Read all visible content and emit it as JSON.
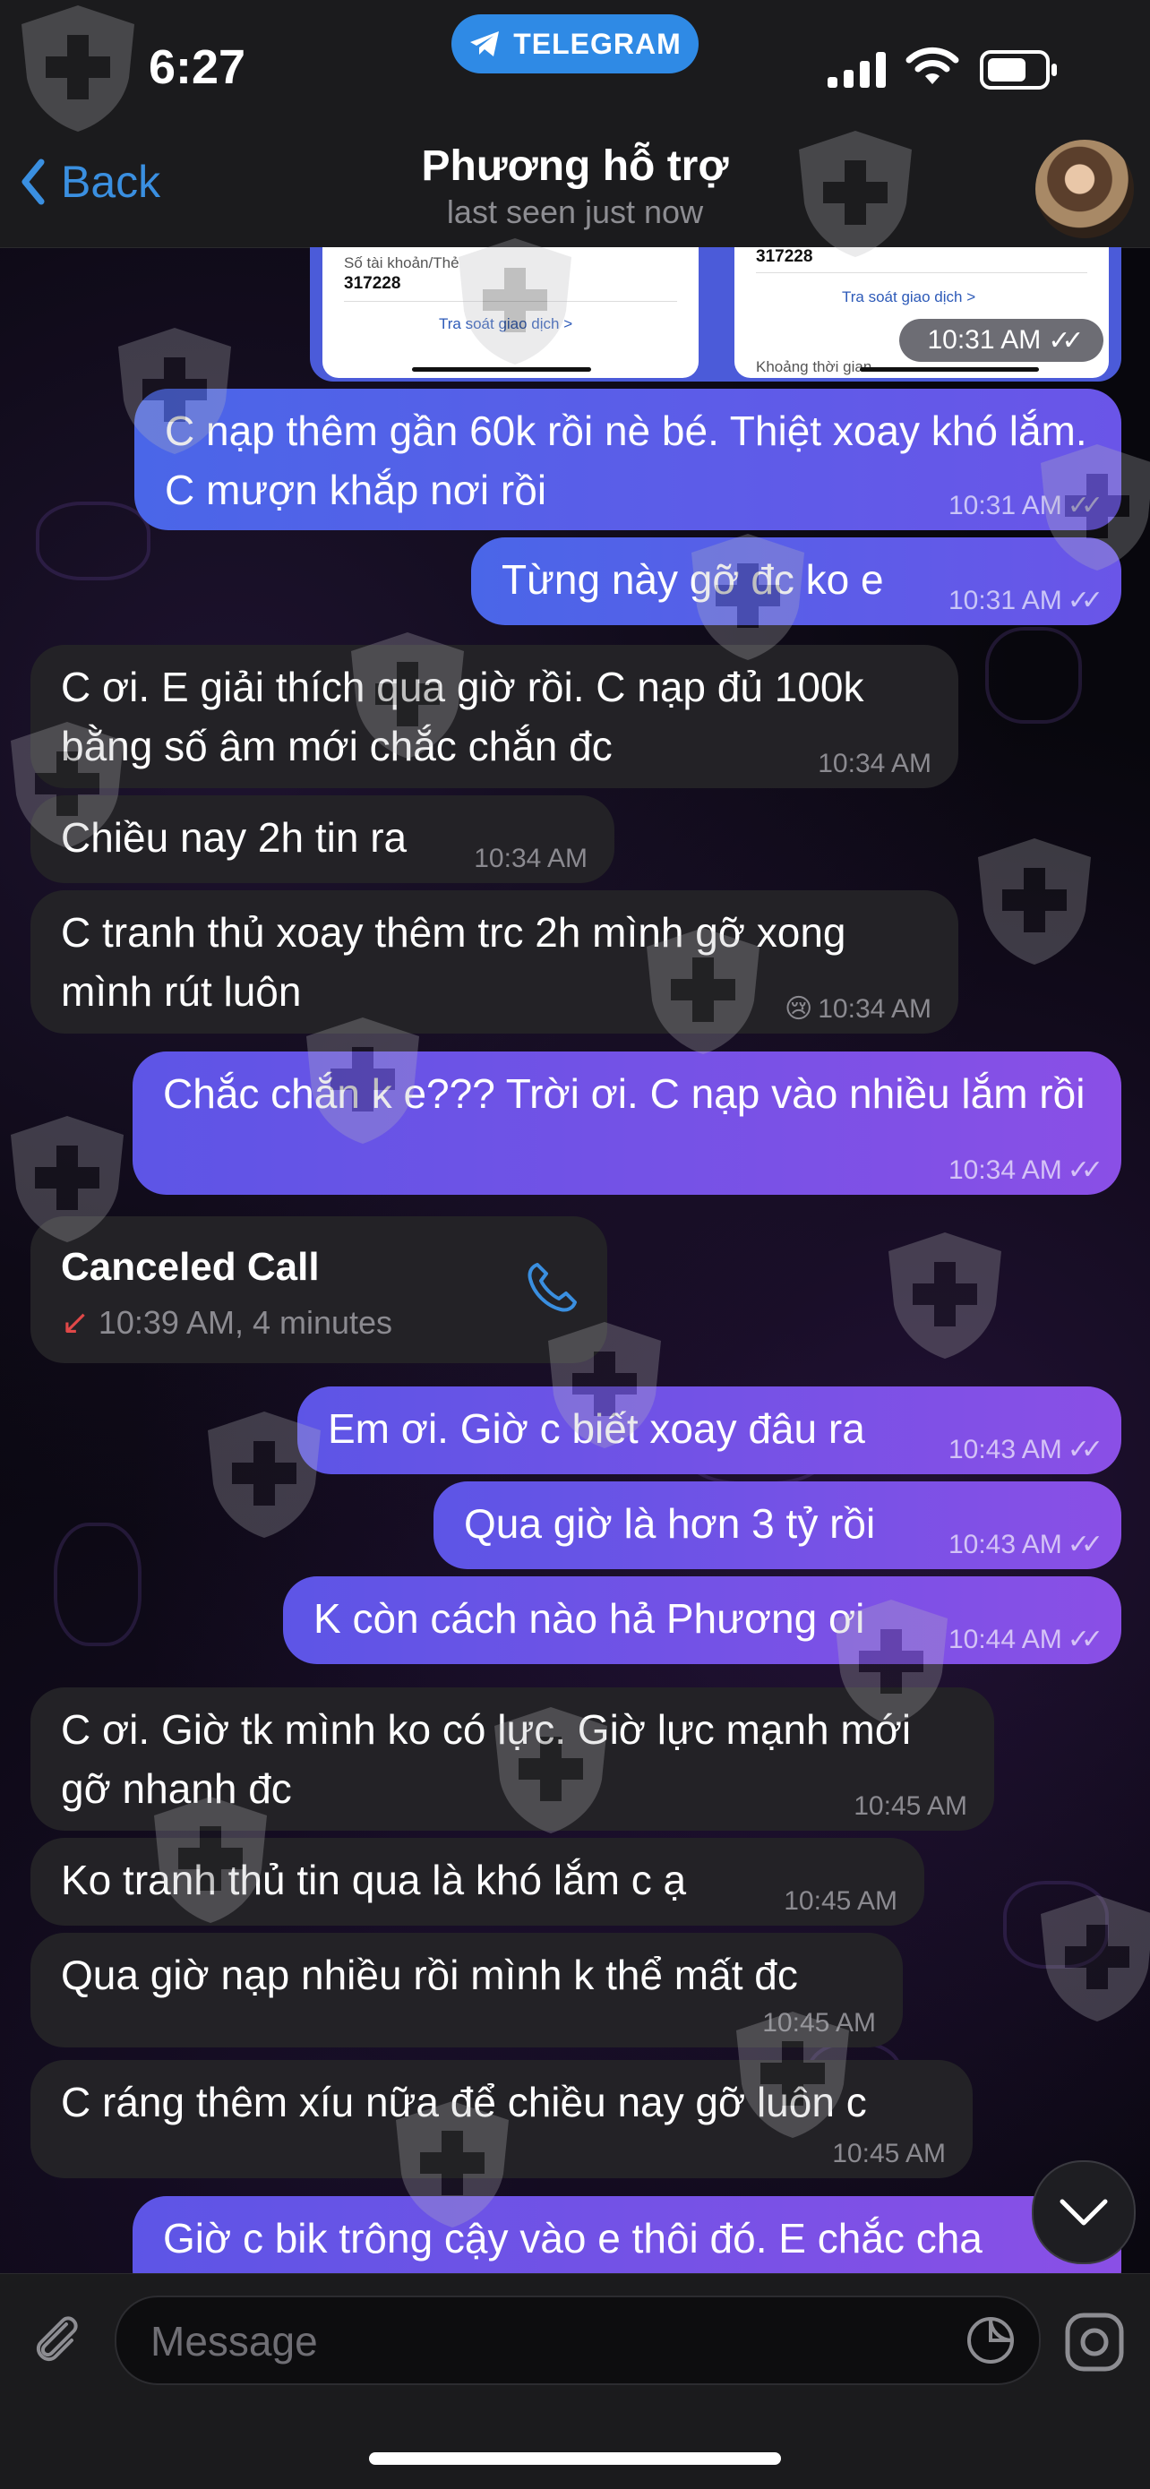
{
  "status_bar": {
    "time": "6:27",
    "app_pill": "TELEGRAM"
  },
  "header": {
    "back_label": "Back",
    "title": "Phương hỗ trợ",
    "subtitle": "last seen just now"
  },
  "image_message": {
    "left_account_label": "Số tài khoản/Thẻ",
    "left_account_number": "317228",
    "left_link": "Tra soát giao dịch >",
    "right_account_number": "317228",
    "right_link": "Tra soát giao dịch >",
    "right_extra": "Khoảng thời gian",
    "time": "10:31 AM"
  },
  "messages": [
    {
      "side": "out",
      "text": "C nạp thêm gần 60k rồi nè bé. Thiệt xoay khó lắm. C mượn khắp nơi rồi",
      "time": "10:31 AM"
    },
    {
      "side": "out",
      "text": "Từng này gỡ đc ko e",
      "time": "10:31 AM"
    },
    {
      "side": "in",
      "text": "C ơi. E giải thích qua giờ rồi. C nạp đủ 100k bằng số âm mới chắc chắn đc",
      "time": "10:34 AM"
    },
    {
      "side": "in",
      "text": "Chiều nay 2h tin ra",
      "time": "10:34 AM"
    },
    {
      "side": "in",
      "text": "C tranh thủ xoay thêm trc 2h mình gỡ xong mình rút luôn",
      "emoji": "😢",
      "time": "10:34 AM"
    },
    {
      "side": "out",
      "text": "Chắc chắn k e??? Trời ơi. C nạp vào nhiều lắm rồi",
      "time": "10:34 AM"
    },
    {
      "side": "out",
      "text": "Em ơi. Giờ c biết xoay đâu ra",
      "time": "10:43 AM"
    },
    {
      "side": "out",
      "text": "Qua giờ là hơn 3 tỷ rồi",
      "time": "10:43 AM"
    },
    {
      "side": "out",
      "text": "K còn cách nào hả Phương ơi",
      "time": "10:44 AM"
    },
    {
      "side": "in",
      "text": "C ơi. Giờ tk mình ko có lực. Giờ lực mạnh mới gỡ nhanh đc",
      "time": "10:45 AM"
    },
    {
      "side": "in",
      "text": "Ko tranh thủ tin qua là khó lắm c ạ",
      "time": "10:45 AM"
    },
    {
      "side": "in",
      "text": "Qua giờ nạp nhiều rồi mình k thể mất đc",
      "time": "10:45 AM"
    },
    {
      "side": "in",
      "text": "C ráng thêm xíu nữa để chiều nay gỡ luôn c",
      "time": "10:45 AM"
    },
    {
      "side": "out",
      "text": "Giờ c bik trông cậy vào e thôi đó. E chắc cha",
      "time": ""
    }
  ],
  "call": {
    "title": "Canceled Call",
    "detail": "10:39 AM, 4 minutes"
  },
  "input": {
    "placeholder": "Message"
  },
  "colors": {
    "outgoing_start": "#5d55e6",
    "outgoing_end": "#8a4fe6",
    "incoming": "#232226",
    "accent": "#3a8fe0",
    "pill": "#2f8ae5"
  }
}
